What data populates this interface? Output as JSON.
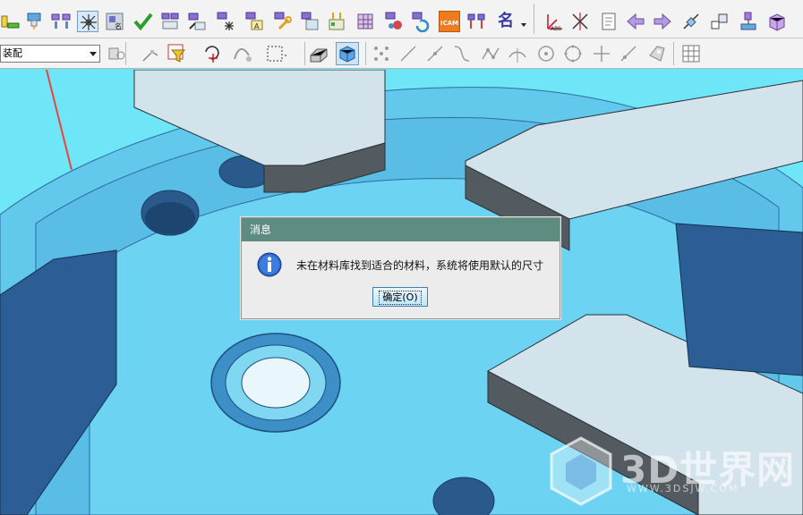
{
  "toolbar": {
    "filter_value": "装配",
    "icam_label": "ICAM",
    "name_label": "名",
    "abs_label": "ABS"
  },
  "dialog": {
    "title": "消息",
    "message": "未在材料库找到适合的材料，系统将使用默认的尺寸",
    "ok_label": "确定(O)"
  },
  "watermark": {
    "text": "3D世界网",
    "url": "WWW.3DSJW.COM"
  },
  "colors": {
    "viewport_bg": "#6fe6f7",
    "dialog_title_bg": "#5e8c80",
    "annotation_arrow": "#e8433f",
    "part_top": "#d2e3ec",
    "part_side": "#535b60"
  },
  "icons": {
    "row1": [
      "assembly-tool-icon",
      "mold-component-icon",
      "mold-pair-icon",
      "grid-snap-icon",
      "parts-library-icon",
      "check-icon",
      "mold-base-icon",
      "mold-edit-icon",
      "mold-spark-icon",
      "mold-text-icon",
      "mold-tools-icon",
      "mold-clone-icon",
      "electrode-icon",
      "mold-grid-icon",
      "mold-color-icon",
      "mold-refresh-icon",
      "icam-icon",
      "mold-insert-icon",
      "name-icon",
      "abs-csys-icon",
      "cross-axis-icon",
      "document-icon",
      "arrow-left-icon",
      "arrow-right-icon",
      "transform-icon",
      "scale-icon",
      "wave-link-icon",
      "box-3d-icon"
    ],
    "row2": [
      "selection-filter-icon",
      "point-snap-icon",
      "filter-funnel-icon",
      "rotate-snap-icon",
      "snap-chain-icon",
      "rectangle-select-icon",
      "solid-shaded-icon",
      "view-cube-icon",
      "point-cloud-icon",
      "line-icon",
      "line-arrow-icon",
      "curve-icon",
      "polyline-icon",
      "arc-mid-icon",
      "circle-center-icon",
      "circle-icon",
      "cross-point-icon",
      "diagonal-line-icon",
      "face-icon",
      "grid-icon"
    ]
  }
}
